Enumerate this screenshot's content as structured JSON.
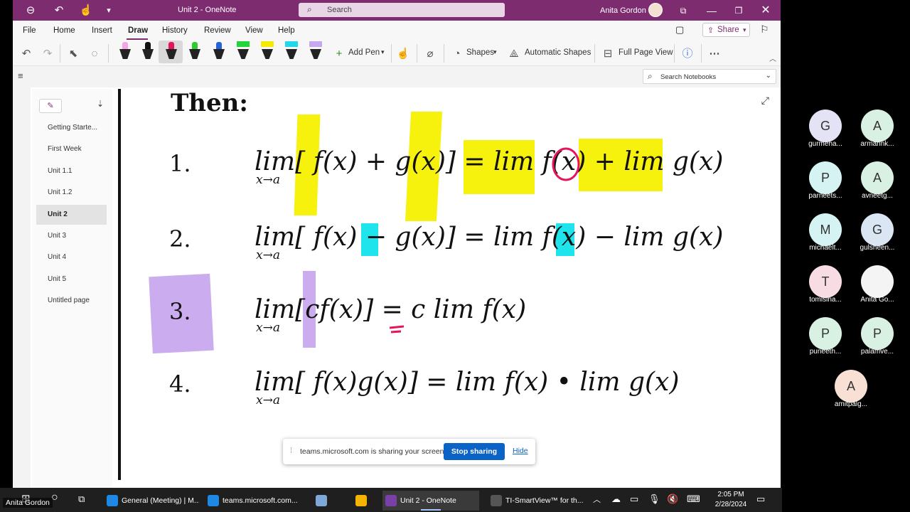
{
  "window": {
    "doc_title": "Unit 2  -  OneNote",
    "search_placeholder": "Search",
    "user_name": "Anita Gordon"
  },
  "menu": {
    "items": [
      "File",
      "Home",
      "Insert",
      "Draw",
      "History",
      "Review",
      "View",
      "Help"
    ],
    "active": "Draw",
    "share_label": "Share"
  },
  "ribbon": {
    "add_pen_label": "Add Pen",
    "shapes_label": "Shapes",
    "auto_shapes_label": "Automatic Shapes",
    "full_page_label": "Full Page View",
    "pens": [
      {
        "type": "pen",
        "color": "#f4a6e4"
      },
      {
        "type": "pen",
        "color": "#111111"
      },
      {
        "type": "pen",
        "color": "#e8135f"
      },
      {
        "type": "pen",
        "color": "#2fcc2f"
      },
      {
        "type": "pen",
        "color": "#2563d6"
      },
      {
        "type": "highlighter",
        "color": "#21d63a"
      },
      {
        "type": "highlighter",
        "color": "#f3ec00"
      },
      {
        "type": "highlighter",
        "color": "#21d8e8"
      },
      {
        "type": "highlighter",
        "color": "#c9a6f0"
      }
    ]
  },
  "notebook": {
    "search_placeholder": "Search Notebooks",
    "pages": [
      "Getting Starte...",
      "First Week",
      "Unit 1.1",
      "Unit 1.2",
      "Unit 2",
      "Unit 3",
      "Unit 4",
      "Unit 5",
      "Untitled page"
    ],
    "active_page": "Unit 2"
  },
  "content": {
    "heading": "Then:",
    "rules": [
      {
        "num": "1.",
        "lhs": "lim[ f(x) + g(x)] = lim f(x) + lim g(x)"
      },
      {
        "num": "2.",
        "lhs": "lim[ f(x) − g(x)] = lim f(x) − lim g(x)"
      },
      {
        "num": "3.",
        "lhs": "lim[cf(x)] = c lim f(x)"
      },
      {
        "num": "4.",
        "lhs": "lim[ f(x)g(x)] = lim f(x) • lim g(x)"
      }
    ],
    "sub": "x→a"
  },
  "share_banner": {
    "message": "teams.microsoft.com is sharing your screen.",
    "stop_label": "Stop sharing",
    "hide_label": "Hide"
  },
  "participants": [
    {
      "initial": "G",
      "name": "gurmeha...",
      "color": "#e3e3f5"
    },
    {
      "initial": "A",
      "name": "armannk...",
      "color": "#d9f1e3"
    },
    {
      "initial": "P",
      "name": "parneets...",
      "color": "#d6f3f3"
    },
    {
      "initial": "A",
      "name": "avneetg...",
      "color": "#d9f1e3"
    },
    {
      "initial": "M",
      "name": "michaelt...",
      "color": "#d6f3f3"
    },
    {
      "initial": "G",
      "name": "gulsheen...",
      "color": "#dbe6f5"
    },
    {
      "initial": "T",
      "name": "tomisina...",
      "color": "#f7dde3"
    },
    {
      "initial": "",
      "name": "Anita Go...",
      "color": "#f4f4f4"
    },
    {
      "initial": "P",
      "name": "puneeth...",
      "color": "#d9f1e3"
    },
    {
      "initial": "P",
      "name": "palamve...",
      "color": "#d9f1e3"
    },
    {
      "initial": "A",
      "name": "amitpalg...",
      "color": "#f8e1d4"
    }
  ],
  "taskbar": {
    "apps": [
      {
        "label": "General (Meeting) | M...",
        "color": "#1e88e5"
      },
      {
        "label": "teams.microsoft.com...",
        "color": "#1e88e5"
      },
      {
        "label": "",
        "color": "#7fa8d8"
      },
      {
        "label": "",
        "color": "#f5b400"
      },
      {
        "label": "Unit 2 - OneNote",
        "color": "#7b3fa8"
      },
      {
        "label": "TI-SmartView™ for th...",
        "color": "#555555"
      }
    ],
    "time": "2:05 PM",
    "date": "2/28/2024",
    "presenter_label": "Anita Gordon"
  }
}
